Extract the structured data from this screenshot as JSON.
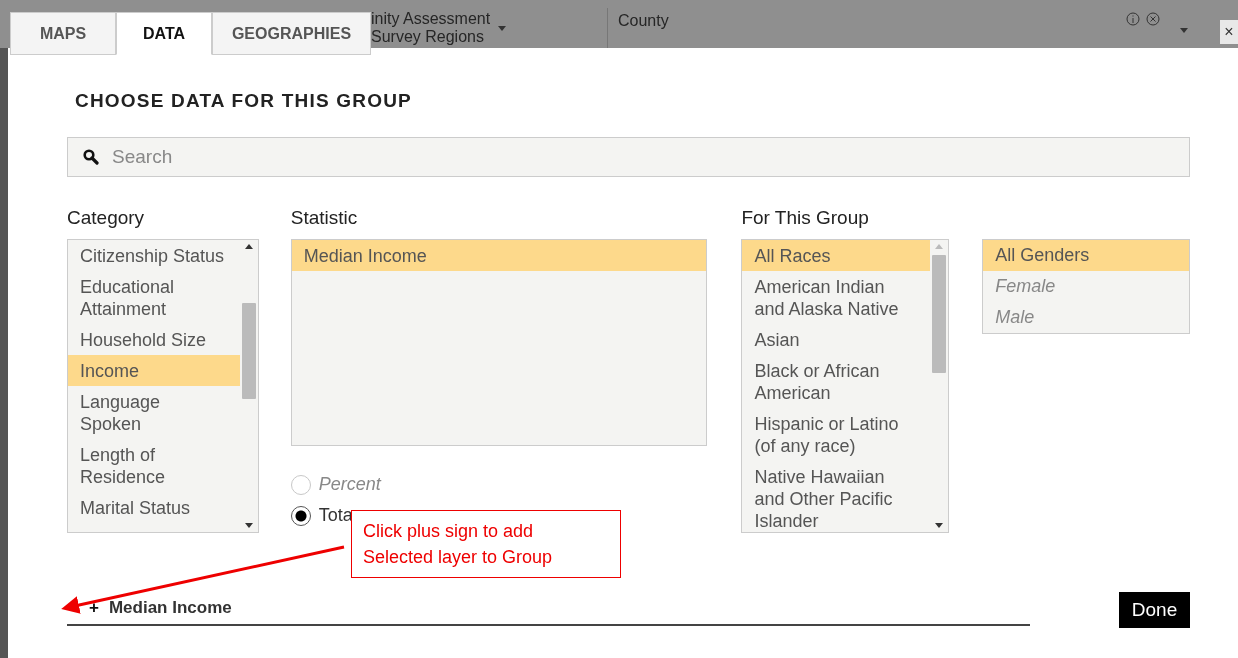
{
  "background": {
    "field_1": [
      "inity Assessment",
      "Survey Regions"
    ],
    "field_2": "County",
    "close": "×"
  },
  "tabs": [
    {
      "label": "MAPS",
      "selected": false
    },
    {
      "label": "DATA",
      "selected": true
    },
    {
      "label": "GEOGRAPHIES",
      "selected": false
    }
  ],
  "title": "CHOOSE DATA FOR THIS GROUP",
  "search": {
    "placeholder": "Search"
  },
  "category": {
    "label": "Category",
    "items": [
      {
        "label": "Citizenship Status",
        "selected": false
      },
      {
        "label": "Educational Attainment",
        "selected": false
      },
      {
        "label": "Household Size",
        "selected": false
      },
      {
        "label": "Income",
        "selected": true
      },
      {
        "label": "Language Spoken",
        "selected": false
      },
      {
        "label": "Length of Residence",
        "selected": false
      },
      {
        "label": "Marital Status",
        "selected": false
      }
    ]
  },
  "statistic": {
    "label": "Statistic",
    "items": [
      {
        "label": "Median Income",
        "selected": true
      }
    ],
    "options": [
      {
        "label": "Percent",
        "selected": false,
        "disabled": true
      },
      {
        "label": "Tota",
        "selected": true,
        "disabled": false
      }
    ]
  },
  "group": {
    "label": "For This Group",
    "races": [
      {
        "label": "All Races",
        "selected": true
      },
      {
        "label": "American Indian and Alaska Native",
        "selected": false
      },
      {
        "label": "Asian",
        "selected": false
      },
      {
        "label": "Black or African American",
        "selected": false
      },
      {
        "label": "Hispanic or Latino (of any race)",
        "selected": false
      },
      {
        "label": "Native Hawaiian and Other Pacific Islander",
        "selected": false
      }
    ],
    "genders": [
      {
        "label": "All Genders",
        "selected": true,
        "disabled": false
      },
      {
        "label": "Female",
        "selected": false,
        "disabled": true
      },
      {
        "label": "Male",
        "selected": false,
        "disabled": true
      }
    ]
  },
  "layer": {
    "plus": "+",
    "label": "Median Income"
  },
  "done": "Done",
  "callout": [
    "Click plus sign to add",
    "Selected layer to Group"
  ]
}
